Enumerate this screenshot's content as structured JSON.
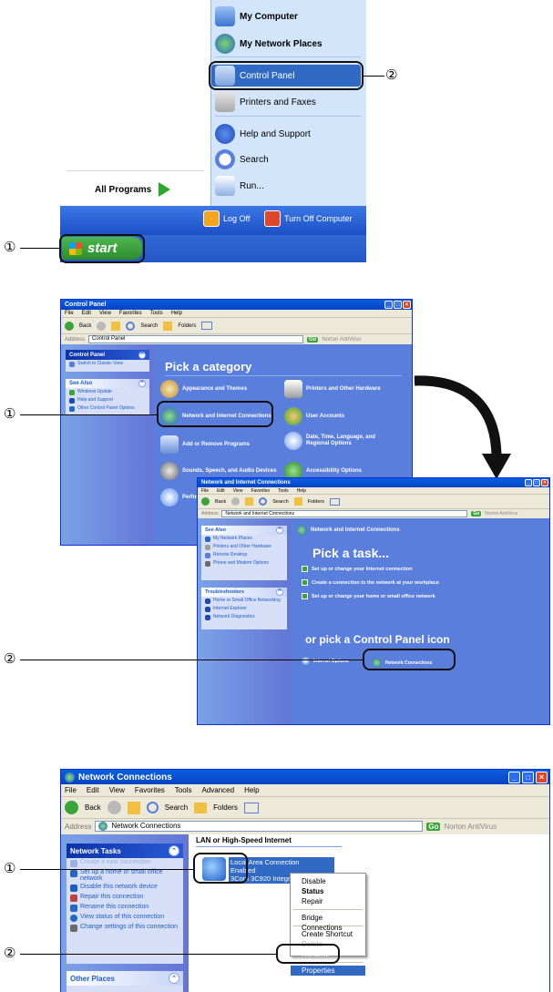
{
  "panel1": {
    "right_items": [
      "My Computer",
      "My Network Places",
      "Control Panel",
      "Printers and Faxes",
      "Help and Support",
      "Search",
      "Run..."
    ],
    "all_programs": "All Programs",
    "log_off": "Log Off",
    "turn_off": "Turn Off Computer",
    "start": "start",
    "callout1": "①",
    "callout2": "②"
  },
  "panel2": {
    "title": "Control Panel",
    "menu": [
      "File",
      "Edit",
      "View",
      "Favorites",
      "Tools",
      "Help"
    ],
    "toolbar": {
      "back": "Back",
      "search": "Search",
      "folders": "Folders"
    },
    "address_label": "Address",
    "address_value": "Control Panel",
    "go": "Go",
    "norton": "Norton AntiVirus",
    "sidebar_header": "Control Panel",
    "switch_view": "Switch to Classic View",
    "see_also": "See Also",
    "see_also_items": [
      "Windows Update",
      "Help and Support",
      "Other Control Panel Options"
    ],
    "pick_category": "Pick a category",
    "categories": [
      "Appearance and Themes",
      "Printers and Other Hardware",
      "Network and Internet Connections",
      "User Accounts",
      "Add or Remove Programs",
      "Date, Time, Language, and Regional Options",
      "Sounds, Speech, and Audio Devices",
      "Accessibility Options",
      "Performance and Maintenance"
    ],
    "callout1": "①"
  },
  "panel3": {
    "title": "Network and Internet Connections",
    "menu": [
      "File",
      "Edit",
      "View",
      "Favorites",
      "Tools",
      "Help"
    ],
    "toolbar": {
      "back": "Back",
      "search": "Search",
      "folders": "Folders"
    },
    "address_label": "Address",
    "address_value": "Network and Internet Connections",
    "go": "Go",
    "norton": "Norton AntiVirus",
    "see_also": "See Also",
    "see_also_items": [
      "My Network Places",
      "Printers and Other Hardware",
      "Remote Desktop",
      "Phone and Modem Options"
    ],
    "troubleshooters": "Troubleshooters",
    "trouble_items": [
      "Home or Small Office Networking",
      "Internet Explorer",
      "Network Diagnostics"
    ],
    "header": "Network and Internet Connections",
    "pick_task": "Pick a task...",
    "tasks": [
      "Set up or change your Internet connection",
      "Create a connection to the network at your workplace",
      "Set up or change your home or small office network"
    ],
    "pick_icon": "or pick a Control Panel icon",
    "icons": [
      "Internet Options",
      "Network Connections"
    ],
    "callout2": "②"
  },
  "panel4": {
    "title": "Network Connections",
    "menu": [
      "File",
      "Edit",
      "View",
      "Favorites",
      "Tools",
      "Advanced",
      "Help"
    ],
    "toolbar": {
      "back": "Back",
      "search": "Search",
      "folders": "Folders"
    },
    "address_label": "Address",
    "address_value": "Network Connections",
    "go": "Go",
    "norton": "Norton AntiVirus",
    "network_tasks": "Network Tasks",
    "tasks": [
      "Create a new connection",
      "Set up a home or small office network",
      "Disable this network device",
      "Repair this connection",
      "Rename this connection",
      "View status of this connection",
      "Change settings of this connection"
    ],
    "other_places": "Other Places",
    "section": "LAN or High-Speed Internet",
    "conn_name": "Local Area Connection",
    "conn_status": "Enabled",
    "conn_device": "3Com 3C920 Integrated Fast Ethernet",
    "context_menu": [
      "Disable",
      "Status",
      "Repair",
      "Bridge Connections",
      "Create Shortcut",
      "Delete",
      "Rename",
      "Properties"
    ],
    "callout1": "①",
    "callout2": "②"
  }
}
